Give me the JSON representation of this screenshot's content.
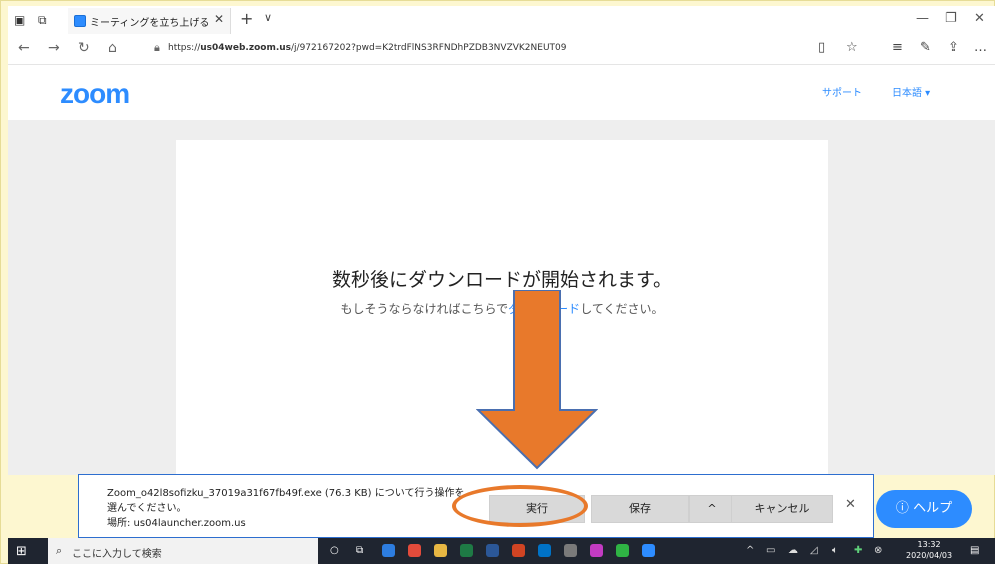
{
  "browser": {
    "tab_title": "ミーティングを立ち上げる - ;",
    "url_prefix": "https://",
    "url_domain": "us04web.zoom.us",
    "url_rest": "/j/972167202?pwd=K2trdFlNS3RFNDhPZDB3NVZVK2NEUT09"
  },
  "header": {
    "logo": "zoom",
    "support": "サポート",
    "language": "日本語 ▾"
  },
  "main": {
    "headline": "数秒後にダウンロードが開始されます。",
    "subline_before": "もしそうならなければこちらで",
    "subline_link": "ダウンロード",
    "subline_after": "してください。"
  },
  "download_bar": {
    "line1": "Zoom_o42l8sofizku_37019a31f67fb49f.exe (76.3 KB) について行う操作を",
    "line2": "選んでください。",
    "line3": "場所: us04launcher.zoom.us",
    "run_label": "実行",
    "save_label": "保存",
    "chevron_label": "^",
    "cancel_label": "キャンセル",
    "close_label": "✕"
  },
  "help_button": {
    "label": "ヘルプ"
  },
  "taskbar": {
    "search_placeholder": "ここに入力して検索",
    "time": "13:32",
    "date": "2020/04/03"
  },
  "colors": {
    "accent": "#2d8cff",
    "arrow": "#e8792b",
    "taskbar": "#1f2530"
  }
}
